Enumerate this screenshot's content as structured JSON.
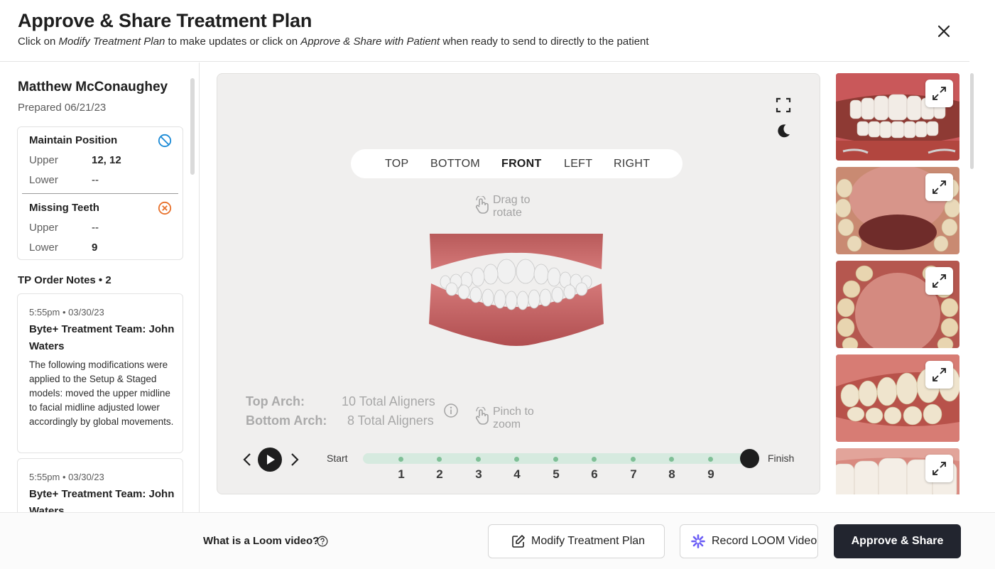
{
  "header": {
    "title": "Approve & Share Treatment Plan",
    "subtitle_pre": "Click on ",
    "subtitle_em1": "Modify Treatment Plan",
    "subtitle_mid": " to make updates or click on ",
    "subtitle_em2": "Approve & Share with Patient",
    "subtitle_post": " when ready to send to directly to the patient",
    "close_icon": "close-icon"
  },
  "sidebar": {
    "patient_name": "Matthew McConaughey",
    "prepared": "Prepared 06/21/23",
    "conditions": [
      {
        "title": "Maintain Position",
        "icon": "no-symbol-icon",
        "icon_color": "#1a8ad6",
        "upper_label": "Upper",
        "upper_value": "12, 12",
        "lower_label": "Lower",
        "lower_value": "--"
      },
      {
        "title": "Missing Teeth",
        "icon": "x-circle-icon",
        "icon_color": "#e8702a",
        "upper_label": "Upper",
        "upper_value": "--",
        "lower_label": "Lower",
        "lower_value": "9"
      }
    ],
    "notes_heading": "TP Order Notes • 2",
    "notes": [
      {
        "time": "5:55pm  •  03/30/23",
        "author": "Byte+ Treatment Team: John Waters",
        "body": "The following modifications were applied to the Setup & Staged models: moved the upper midline to facial midline adjusted lower accordingly by global movements."
      },
      {
        "time": "5:55pm  •  03/30/23",
        "author": "Byte+ Treatment Team: John Waters",
        "body": ""
      }
    ]
  },
  "viewer": {
    "tabs": [
      "TOP",
      "BOTTOM",
      "FRONT",
      "LEFT",
      "RIGHT"
    ],
    "active_tab": "FRONT",
    "drag_hint_line1": "Drag to",
    "drag_hint_line2": "rotate",
    "pinch_hint_line1": "Pinch to",
    "pinch_hint_line2": "zoom",
    "top_arch_label": "Top Arch:",
    "top_arch_value": "10 Total Aligners",
    "bottom_arch_label": "Bottom Arch:",
    "bottom_arch_value": "8 Total Aligners",
    "timeline_start": "Start",
    "timeline_finish": "Finish",
    "timeline_steps": [
      "1",
      "2",
      "3",
      "4",
      "5",
      "6",
      "7",
      "8",
      "9"
    ],
    "timeline_position": "Finish",
    "icons": [
      "fullscreen-icon",
      "moon-icon",
      "hand-drag-icon",
      "hand-pinch-icon",
      "info-icon",
      "play-icon"
    ]
  },
  "photos": {
    "count_visible": 5,
    "descriptions": [
      "frontal-smile",
      "lower-occlusal",
      "upper-occlusal",
      "right-buccal",
      "closeup-front"
    ]
  },
  "footer": {
    "loom_question": "What is a Loom video?",
    "modify_label": "Modify Treatment Plan",
    "record_label": "Record LOOM Video",
    "approve_label": "Approve & Share"
  },
  "colors": {
    "primary_button": "#22252f",
    "timeline_track": "#d6eadf",
    "timeline_dot": "#7fbf96",
    "maintain_icon": "#1a8ad6",
    "missing_icon": "#e8702a",
    "loom_accent": "#6a5cf6"
  }
}
